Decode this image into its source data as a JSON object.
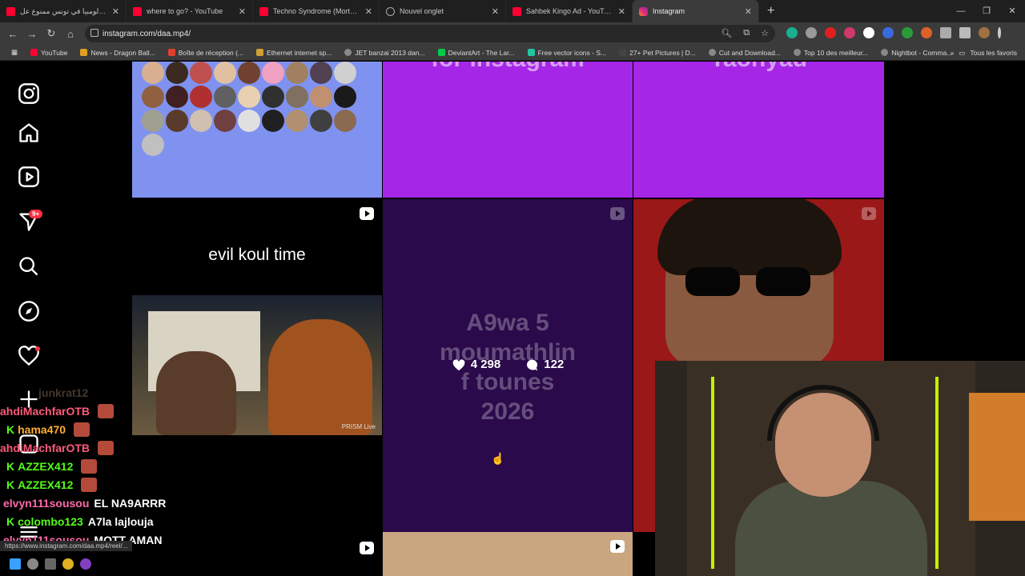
{
  "browser": {
    "tabs": [
      {
        "title": "حي كولومبيا في تونس ممنوع عل",
        "favicon": "youtube-icon",
        "active": false
      },
      {
        "title": "where to go? - YouTube",
        "favicon": "youtube-icon",
        "active": false
      },
      {
        "title": "Techno Syndrome (Mortal Kom",
        "favicon": "youtube-icon",
        "active": false
      },
      {
        "title": "Nouvel onglet",
        "favicon": "globe-icon",
        "active": false
      },
      {
        "title": "Sahbek Kingo Ad - YouTube",
        "favicon": "youtube-icon",
        "active": false
      },
      {
        "title": "Instagram",
        "favicon": "instagram-icon",
        "active": true
      }
    ],
    "new_tab": "+",
    "window_controls": [
      "—",
      "❐",
      "✕"
    ],
    "address": "instagram.com/daa.mp4/",
    "bookmarks": [
      "YouTube",
      "News - Dragon Ball...",
      "Boîte de réception (...",
      "Ethernet internet sp...",
      "JET banzai 2013 dan...",
      "DeviantArt - The Lar...",
      "Free vector icons - S...",
      "27+ Pet Pictures | D...",
      "Cut and Download...",
      "Top 10 des meilleur...",
      "Nightbot - Comma..."
    ],
    "bookmarks_more": "»",
    "all_bookmarks": "Tous les favoris",
    "status_url": "https://www.instagram.com/daa.mp4/reel/..."
  },
  "sidebar": {
    "notifications_badge": "9+"
  },
  "grid": {
    "tile2_text": "for instagram",
    "tile3_text": "Taohyad",
    "evil_text": "evil koul time",
    "prism_label": "PRISM Live",
    "hover_text": "A9wa 5\nmoumathlin\nf tounes\n2026",
    "likes": "4 298",
    "comments": "122"
  },
  "chat": [
    {
      "user": "junkrat12",
      "msg": "",
      "color": "#7a5a48",
      "kick": false
    },
    {
      "user": "ahdiMachfarOTB",
      "msg": "",
      "color": "#ff5a7a",
      "kick": false
    },
    {
      "user": "hama470",
      "msg": "",
      "color": "#ffb02e",
      "kick": true
    },
    {
      "user": "ahdiMachfarOTB",
      "msg": "",
      "color": "#ff5a7a",
      "kick": false
    },
    {
      "user": "AZZEX412",
      "msg": "",
      "color": "#53fc18",
      "kick": true
    },
    {
      "user": "AZZEX412",
      "msg": "",
      "color": "#53fc18",
      "kick": true
    },
    {
      "user": "elvyn111sousou",
      "msg": "EL NA9ARRR",
      "color": "#ff6aa8",
      "kick": false
    },
    {
      "user": "colombo123",
      "msg": "A7la lajlouja",
      "color": "#53fc18",
      "kick": true
    },
    {
      "user": "elvyn111sousou",
      "msg": "MOTT AMAN",
      "color": "#ff6aa8",
      "kick": false
    }
  ],
  "colors": {
    "accent_red": "#ff3040",
    "kick_green": "#53fc18",
    "tile_purple": "#a526e6",
    "tile_blue": "#8092f0"
  }
}
